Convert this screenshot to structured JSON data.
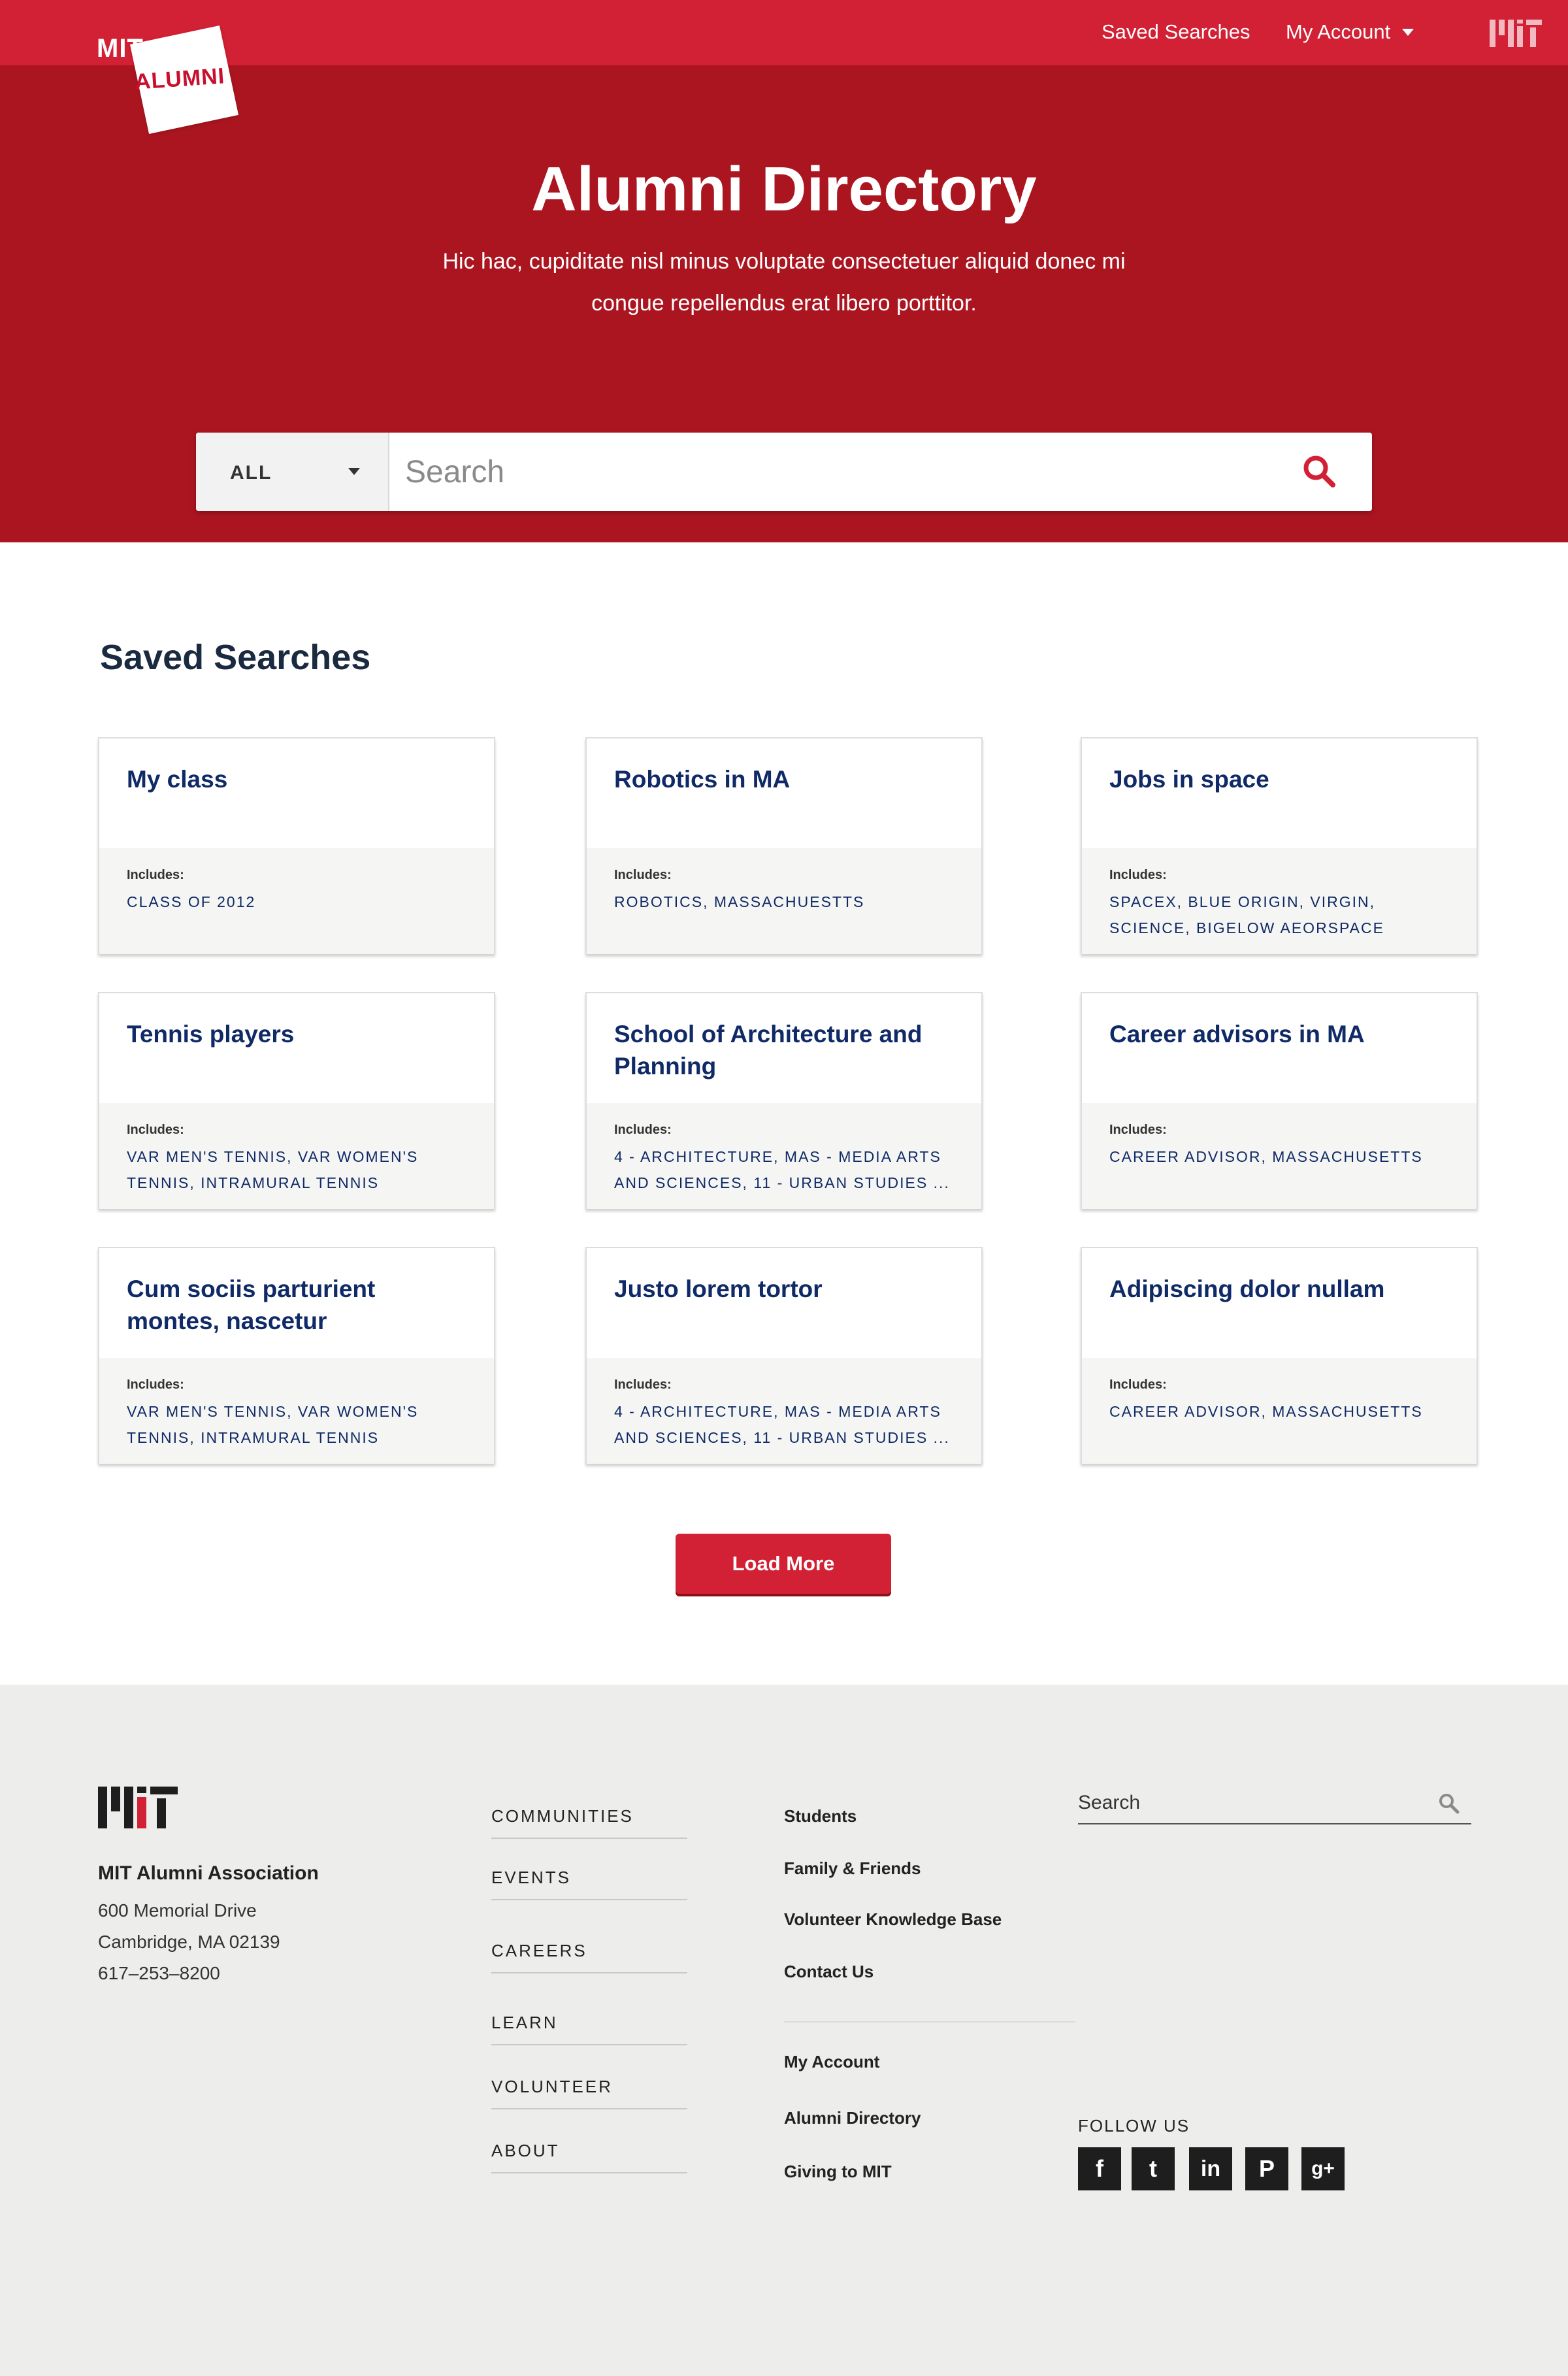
{
  "colors": {
    "brand_red": "#d22034",
    "hero_red": "#ab1520",
    "navy": "#0f2a66",
    "footer_bg": "#ededeb"
  },
  "header": {
    "logo": {
      "line1": "MIT",
      "line2": "ALUMNI"
    },
    "nav": {
      "saved_searches": "Saved Searches",
      "my_account": "My Account"
    }
  },
  "hero": {
    "title": "Alumni Directory",
    "subtitle": "Hic hac, cupiditate nisl minus voluptate consectetuer aliquid donec mi congue repellendus erat libero porttitor.",
    "search": {
      "scope": "ALL",
      "placeholder": "Search",
      "icon": "search-icon"
    }
  },
  "saved_searches": {
    "title": "Saved Searches",
    "includes_label": "Includes:",
    "cards": [
      {
        "title": "My class",
        "tags": "CLASS OF 2012"
      },
      {
        "title": "Robotics in MA",
        "tags": "ROBOTICS, MASSACHUESTTS"
      },
      {
        "title": "Jobs in space",
        "tags": "SPACEX, BLUE ORIGIN, VIRGIN, SCIENCE, BIGELOW AEORSPACE"
      },
      {
        "title": "Tennis players",
        "tags": "VAR MEN'S TENNIS, VAR WOMEN'S TENNIS, INTRAMURAL TENNIS"
      },
      {
        "title": "School of Architecture and Planning",
        "tags": "4 - ARCHITECTURE, MAS - MEDIA ARTS AND SCIENCES, 11 - URBAN STUDIES ..."
      },
      {
        "title": "Career advisors in MA",
        "tags": "CAREER ADVISOR, MASSACHUSETTS"
      },
      {
        "title": "Cum sociis parturient montes, nascetur",
        "tags": "VAR MEN'S TENNIS, VAR WOMEN'S TENNIS, INTRAMURAL TENNIS"
      },
      {
        "title": "Justo lorem tortor",
        "tags": "4 - ARCHITECTURE, MAS - MEDIA ARTS AND SCIENCES, 11 - URBAN STUDIES ..."
      },
      {
        "title": "Adipiscing dolor nullam",
        "tags": "CAREER ADVISOR, MASSACHUSETTS"
      }
    ],
    "load_more": "Load More"
  },
  "footer": {
    "org": {
      "name": "MIT Alumni Association",
      "address1": "600 Memorial Drive",
      "address2": "Cambridge, MA 02139",
      "phone": "617–253–8200"
    },
    "primary_nav": [
      "COMMUNITIES",
      "EVENTS",
      "CAREERS",
      "LEARN",
      "VOLUNTEER",
      "ABOUT"
    ],
    "secondary_nav_top": [
      "Students",
      "Family & Friends",
      "Volunteer Knowledge Base",
      "Contact Us"
    ],
    "secondary_nav_bottom": [
      "My Account",
      "Alumni Directory",
      "Giving to MIT"
    ],
    "search_placeholder": "Search",
    "follow_label": "FOLLOW US",
    "social": [
      {
        "icon": "facebook-icon",
        "glyph": "f"
      },
      {
        "icon": "twitter-icon",
        "glyph": "t"
      },
      {
        "icon": "linkedin-icon",
        "glyph": "in"
      },
      {
        "icon": "pinterest-icon",
        "glyph": "P"
      },
      {
        "icon": "google-plus-icon",
        "glyph": "g+"
      }
    ]
  }
}
